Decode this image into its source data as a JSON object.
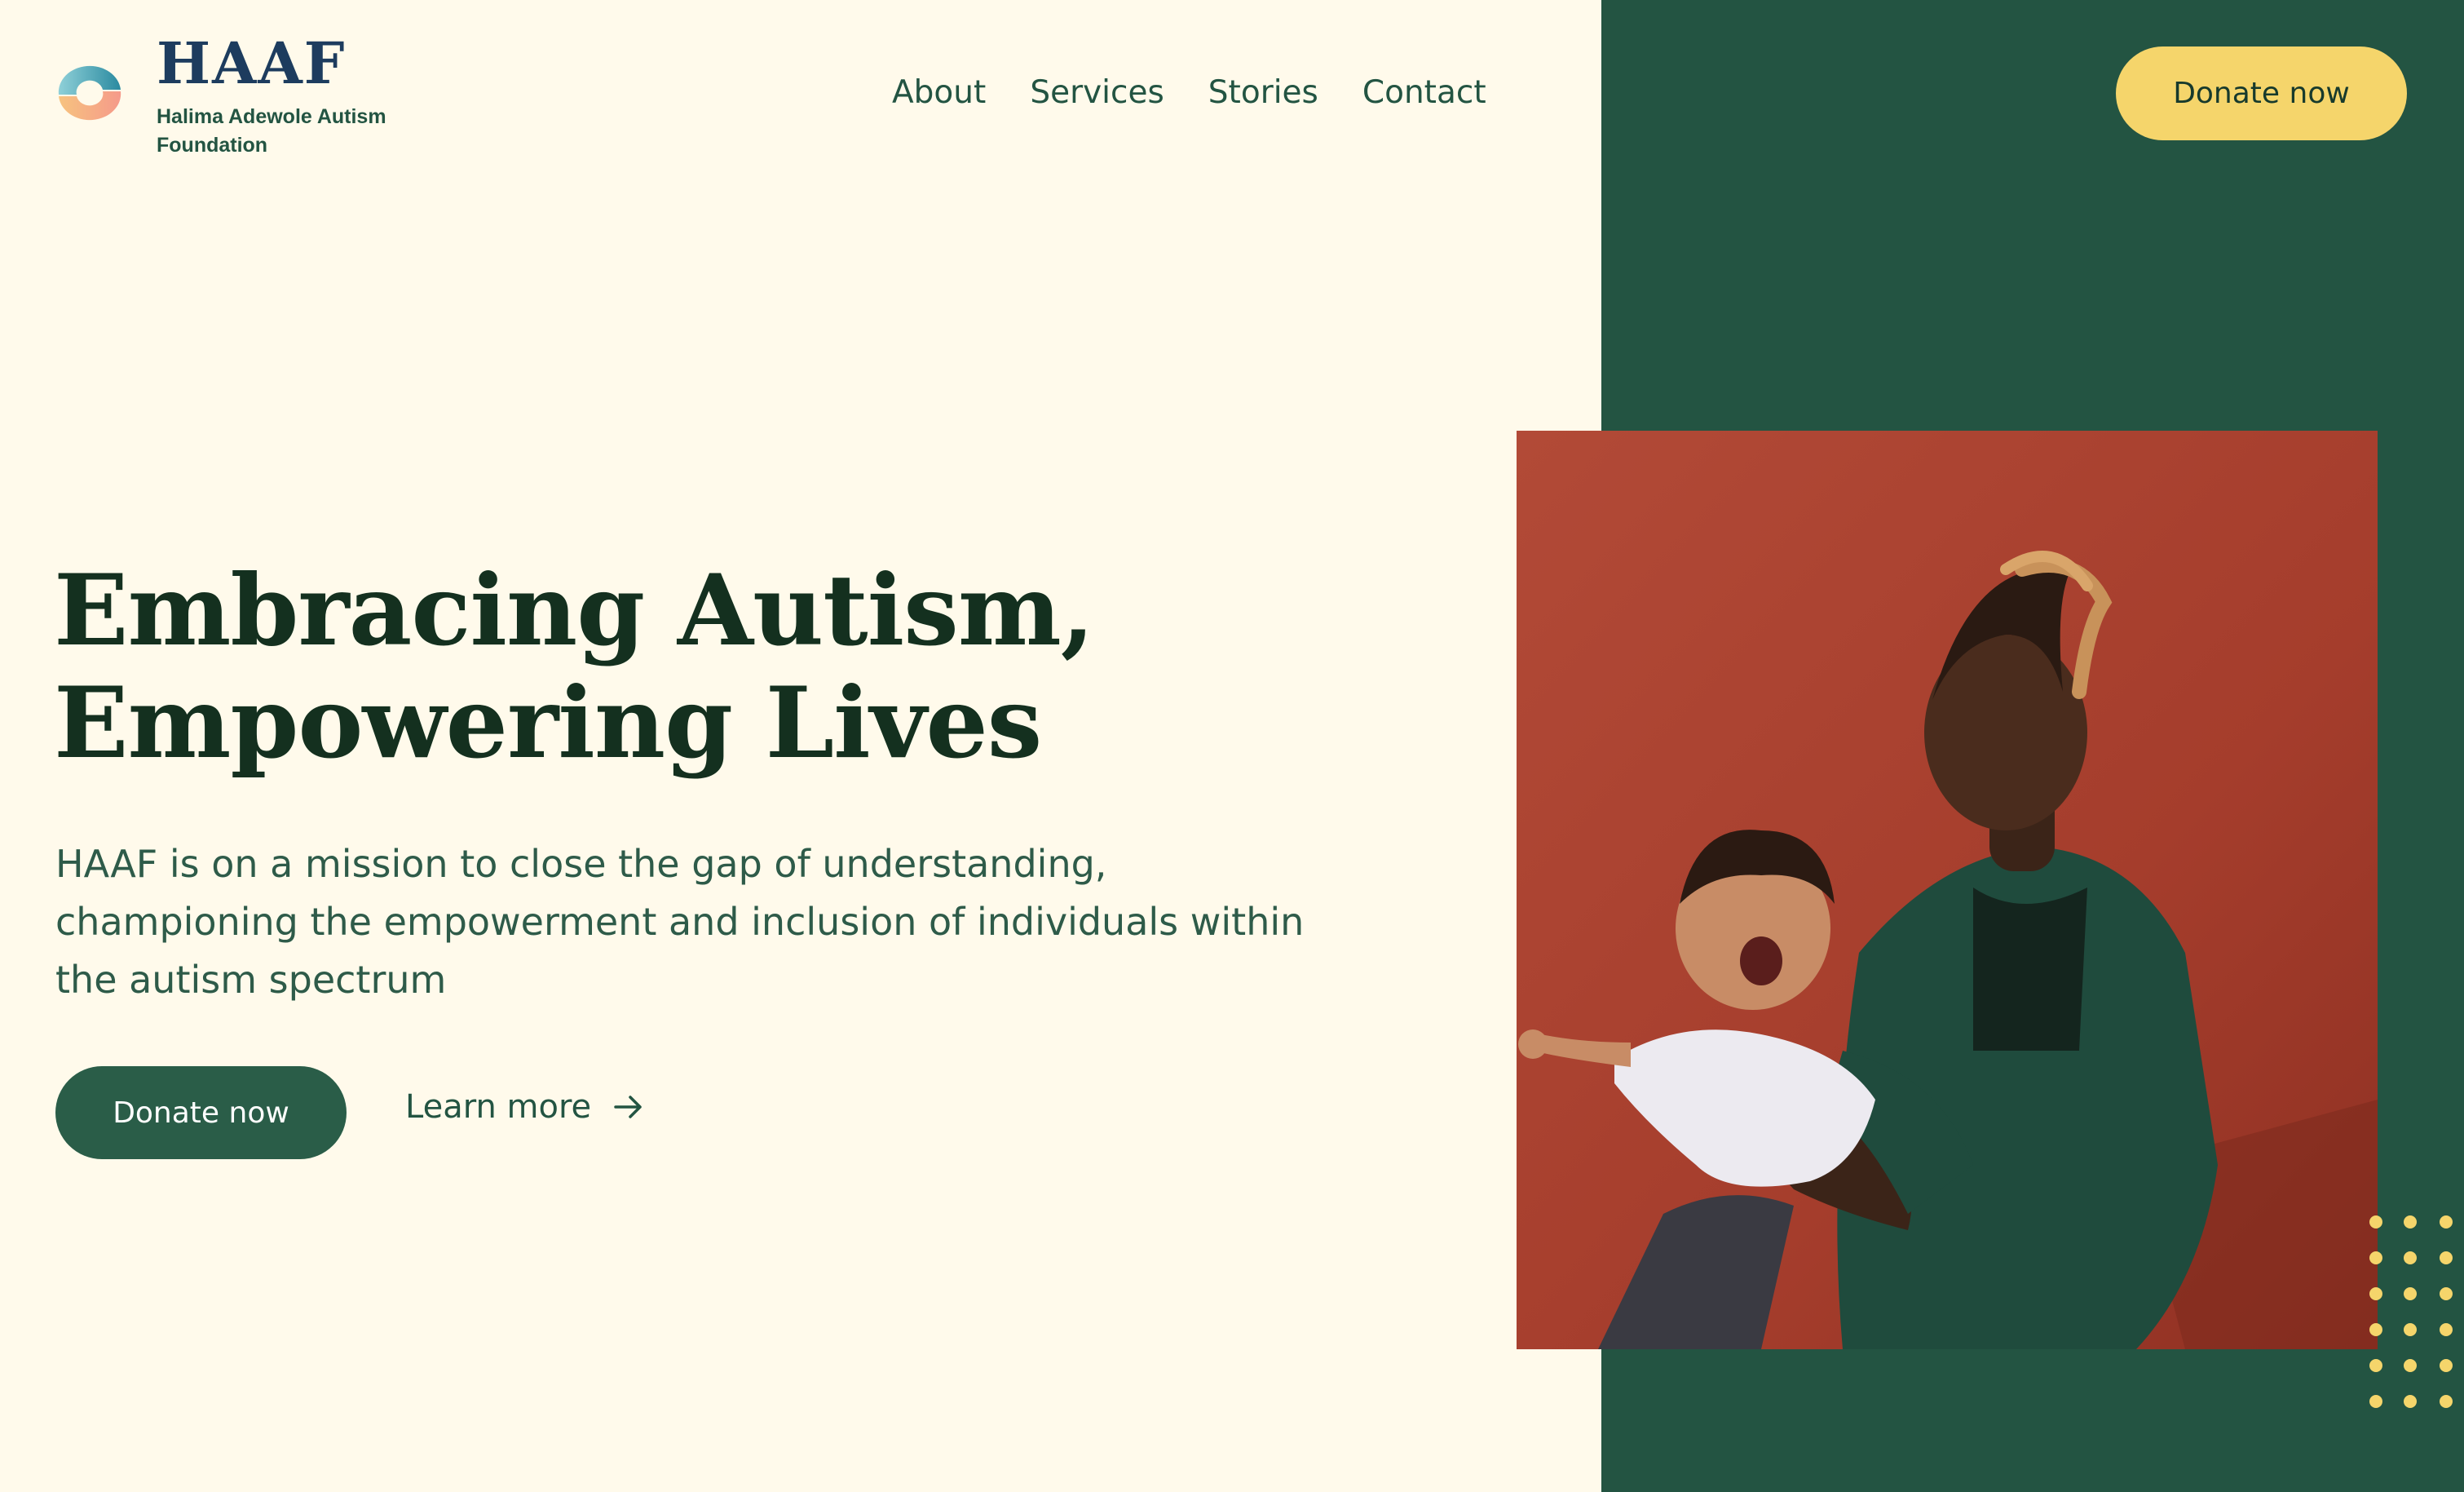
{
  "brand": {
    "abbr": "HAAF",
    "full_name": "Halima Adewole Autism Foundation"
  },
  "nav": {
    "items": [
      {
        "label": "About"
      },
      {
        "label": "Services"
      },
      {
        "label": "Stories"
      },
      {
        "label": "Contact"
      }
    ],
    "donate_label": "Donate now"
  },
  "hero": {
    "title_line1": "Embracing Autism,",
    "title_line2": "Empowering Lives",
    "description": "HAAF is on a mission to close the gap of understanding, championing the empowerment and inclusion of individuals within the autism spectrum",
    "primary_cta": "Donate now",
    "secondary_cta": "Learn more"
  },
  "colors": {
    "background": "#fffaeb",
    "panel": "#235442",
    "accent": "#f5d56b",
    "heading": "#14301f"
  },
  "icons": {
    "logo": "haaf-logo-icon",
    "learn_more": "arrow-right-icon"
  },
  "image": {
    "subject": "father-and-child-photo"
  }
}
